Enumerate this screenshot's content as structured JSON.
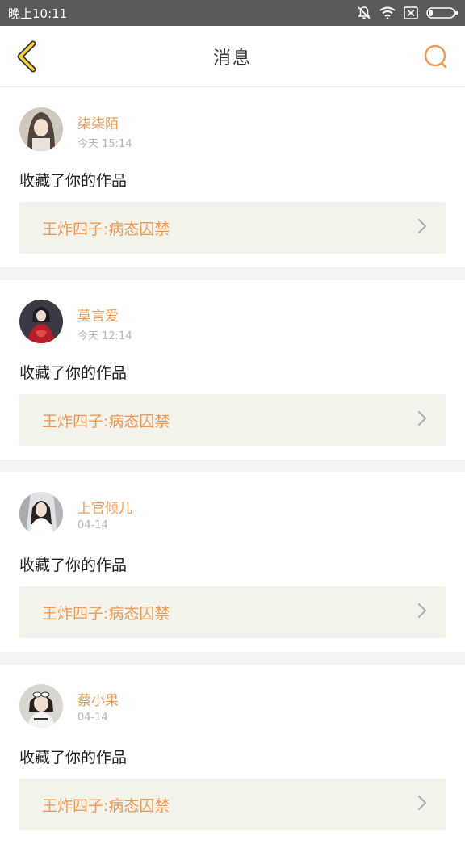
{
  "status_bar": {
    "time": "晚上10:11",
    "icons": [
      "bell-off-icon",
      "wifi-icon",
      "sim-none-icon",
      "battery-icon"
    ]
  },
  "header": {
    "title": "消息",
    "back_icon": "chevron-left-icon",
    "search_icon": "search-icon"
  },
  "accent_color": "#ee9a54",
  "messages": [
    {
      "username": "柒柒陌",
      "time": "今天 15:14",
      "action": "收藏了你的作品",
      "work_title": "王炸四子:病态囚禁",
      "avatar": "avatar"
    },
    {
      "username": "莫言爱",
      "time": "今天 12:14",
      "action": "收藏了你的作品",
      "work_title": "王炸四子:病态囚禁",
      "avatar": "avatar"
    },
    {
      "username": "上官倾儿",
      "time": "04-14",
      "action": "收藏了你的作品",
      "work_title": "王炸四子:病态囚禁",
      "avatar": "avatar"
    },
    {
      "username": "蔡小果",
      "time": "04-14",
      "action": "收藏了你的作品",
      "work_title": "王炸四子:病态囚禁",
      "avatar": "avatar"
    }
  ]
}
